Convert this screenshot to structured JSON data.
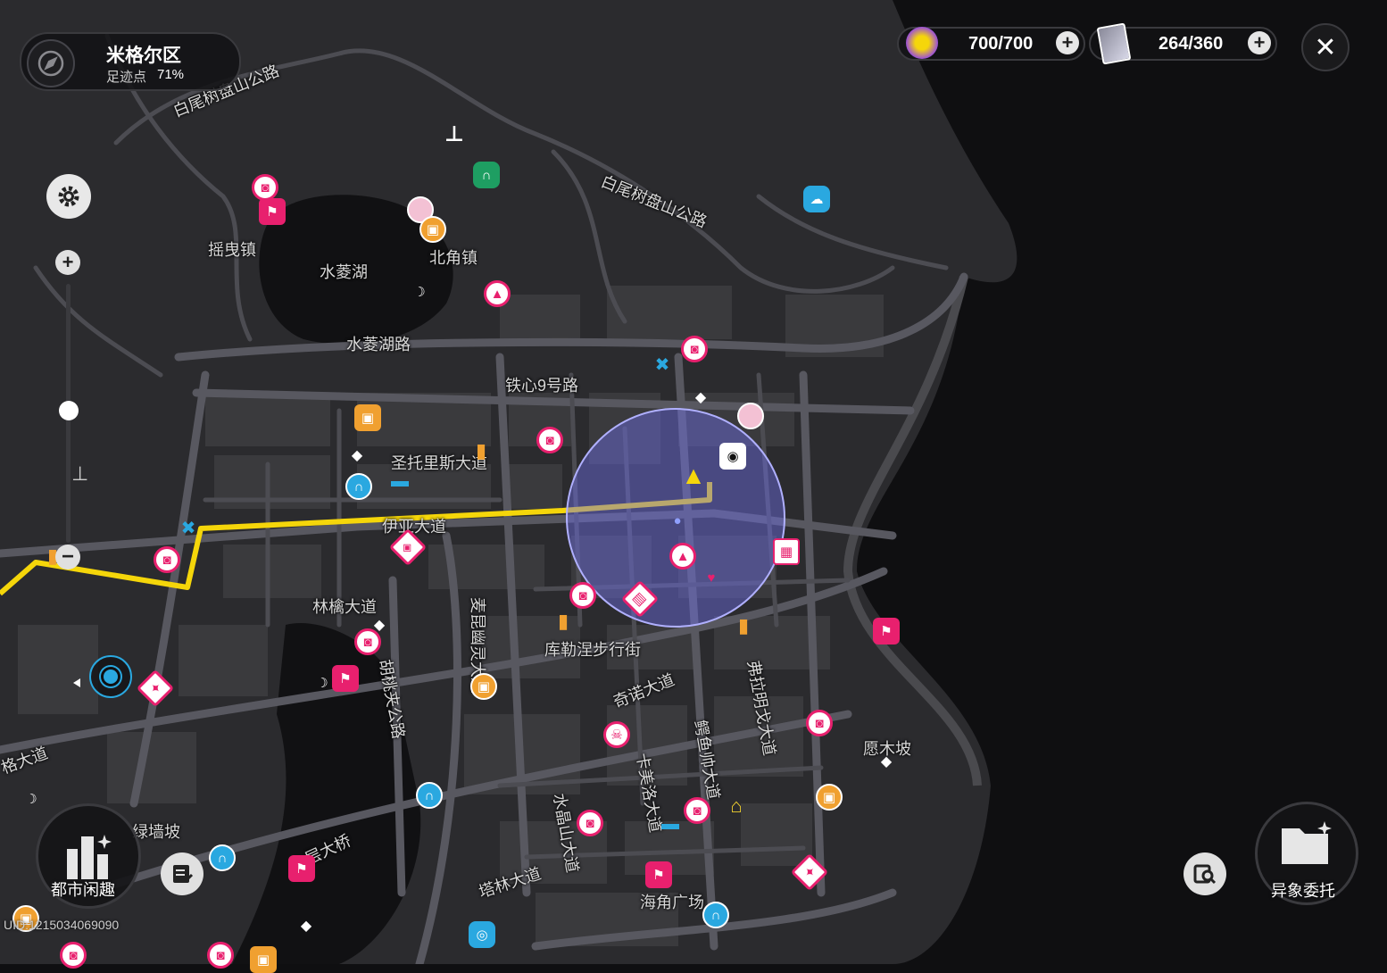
{
  "region": {
    "name": "米格尔区",
    "progress_label": "足迹点",
    "progress_value": "71%"
  },
  "currency": [
    {
      "icon": "battery-energy-icon",
      "value": "700/700"
    },
    {
      "icon": "film-ticket-icon",
      "value": "264/360"
    }
  ],
  "map_labels": {
    "road_baiwei_1": "白尾树盘山公路",
    "road_baiwei_2": "白尾树盘山公路",
    "town_yaoye": "摇曳镇",
    "lake_shuiling": "水菱湖",
    "town_beijiao": "北角镇",
    "road_shuiling": "水菱湖路",
    "road_tiexin": "铁心9号路",
    "street_shengtuo": "圣托里斯大道",
    "street_yiya": "伊亚大道",
    "street_linqin": "林檎大道",
    "street_maikun": "麦昆幽灵大道",
    "street_hutao": "胡桃夹公路",
    "street_kulenie": "库勒涅步行街",
    "street_qinuo": "奇诺大道",
    "street_fulaming": "弗拉明戈大道",
    "street_eyu": "鳄鱼帅大道",
    "street_kamei": "卡美洛大道",
    "street_shuijing": "水晶山大道",
    "street_talin": "塔林大道",
    "place_yuanmu": "愿木坡",
    "place_lvqiang": "绿墙坡",
    "place_haijiao": "海角广场",
    "bridge": "层大桥",
    "street_left": "格大道"
  },
  "buttons": {
    "city_fun": "都市闲趣",
    "anomaly": "异象委托"
  },
  "uid": "UID:1215034069090",
  "colors": {
    "route": "#f5d60a",
    "pink": "#e8206e",
    "cyan": "#2aa8e0",
    "orange": "#f0a030"
  }
}
